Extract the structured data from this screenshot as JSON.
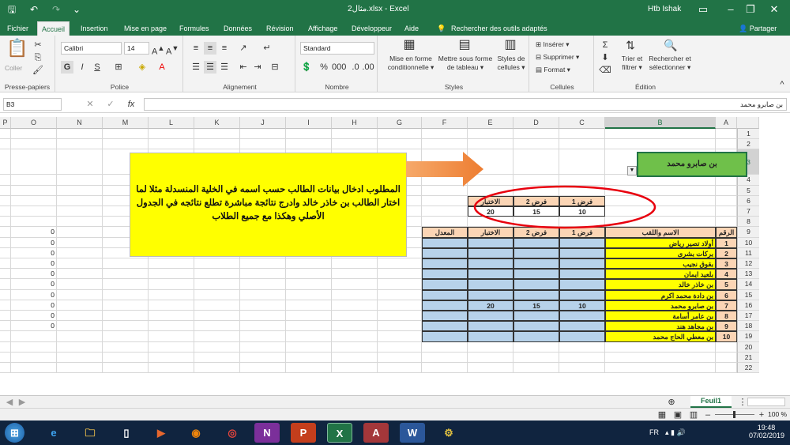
{
  "window": {
    "title": "مثال2.xlsx - Excel",
    "user": "Htb Ishak"
  },
  "tabs": [
    "Fichier",
    "Accueil",
    "Insertion",
    "Mise en page",
    "Formules",
    "Données",
    "Révision",
    "Affichage",
    "Développeur",
    "Aide"
  ],
  "search_text": "Rechercher des outils adaptés",
  "share": "Partager",
  "ribbon": {
    "clipboard": {
      "label": "Presse-papiers",
      "paste": "Coller"
    },
    "font": {
      "label": "Police",
      "name": "Calibri",
      "size": "14",
      "bold": "G",
      "italic": "I",
      "underline": "S"
    },
    "alignment": {
      "label": "Alignement"
    },
    "number": {
      "label": "Nombre",
      "format": "Standard"
    },
    "styles": {
      "label": "Styles",
      "cond": [
        "Mise en forme",
        "conditionnelle ▾"
      ],
      "table": [
        "Mettre sous forme",
        "de tableau ▾"
      ],
      "cellstyles": [
        "Styles de",
        "cellules ▾"
      ]
    },
    "cells": {
      "label": "Cellules",
      "insert": "Insérer ▾",
      "delete": "Supprimer ▾",
      "format": "Format ▾"
    },
    "editing": {
      "label": "Édition",
      "sort": [
        "Trier et",
        "filtrer ▾"
      ],
      "find": [
        "Rechercher et",
        "sélectionner ▾"
      ]
    }
  },
  "formula_bar": {
    "namebox": "B3",
    "fx": "fx",
    "content": "بن صابرو محمد"
  },
  "columns": [
    "A",
    "B",
    "C",
    "D",
    "E",
    "F",
    "G",
    "H",
    "I",
    "J",
    "K",
    "L",
    "M",
    "N",
    "O",
    "P"
  ],
  "rows": [
    "1",
    "2",
    "3",
    "4",
    "5",
    "6",
    "7",
    "8",
    "9",
    "10",
    "11",
    "12",
    "13",
    "14",
    "15",
    "16",
    "17",
    "18",
    "19",
    "20",
    "21",
    "22"
  ],
  "selected_name": "بن صابرو محمد",
  "instruction": "المطلوب ادخال بيانات الطالب حسب اسمه في الخلية المنسدلة مثلا لما اختار الطالب بن خاذر خالد وادرج نتائجة مباشرة تطلع نتائجه في الجدول الأصلي وهكذا مع جميع الطلاب",
  "small_table": {
    "headers": [
      "فرض 1",
      "فرض 2",
      "الاختبار"
    ],
    "values": [
      "10",
      "15",
      "20"
    ]
  },
  "main_table": {
    "headers": {
      "num": "الرقم",
      "name": "الاسم واللقب",
      "f1": "فرض 1",
      "f2": "فرض 2",
      "exam": "الاختبار",
      "avg": "المعدل"
    },
    "rows": [
      {
        "n": "1",
        "name": "أولاد تصير رياض",
        "f1": "",
        "f2": "",
        "ex": ""
      },
      {
        "n": "2",
        "name": "بركات بشرى",
        "f1": "",
        "f2": "",
        "ex": ""
      },
      {
        "n": "3",
        "name": "بقوق نجيب",
        "f1": "",
        "f2": "",
        "ex": ""
      },
      {
        "n": "4",
        "name": "بلعيد ايمان",
        "f1": "",
        "f2": "",
        "ex": ""
      },
      {
        "n": "5",
        "name": "بن خاذر خالد",
        "f1": "",
        "f2": "",
        "ex": ""
      },
      {
        "n": "6",
        "name": "بن دادة محمد اكرم",
        "f1": "",
        "f2": "",
        "ex": ""
      },
      {
        "n": "7",
        "name": "بن صابرو محمد",
        "f1": "10",
        "f2": "15",
        "ex": "20"
      },
      {
        "n": "8",
        "name": "بن عامر أسامة",
        "f1": "",
        "f2": "",
        "ex": ""
      },
      {
        "n": "9",
        "name": "بن مجاهد هند",
        "f1": "",
        "f2": "",
        "ex": ""
      },
      {
        "n": "10",
        "name": "بن معطي الحاج محمد",
        "f1": "",
        "f2": "",
        "ex": ""
      }
    ]
  },
  "col_o_values": [
    "0",
    "0",
    "0",
    "0",
    "0",
    "0",
    "0",
    "0",
    "0",
    "0"
  ],
  "sheet_tab": "Feuil1",
  "zoom": "100 %",
  "taskbar": {
    "lang": "FR",
    "time": "19:48",
    "date": "07/02/2019"
  },
  "colors": {
    "excel_green": "#217346",
    "yellow": "#ffff00",
    "peach": "#fbd5b5",
    "blue_cell": "#b7d2ea",
    "name_box_green": "#6fc04a",
    "arrow": "#ed7d31",
    "circle": "#e8000e"
  }
}
